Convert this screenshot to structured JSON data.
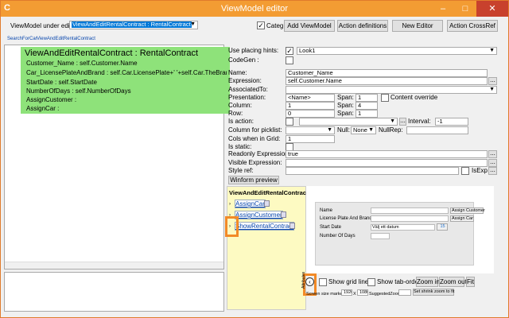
{
  "window": {
    "title": "ViewModel editor",
    "minimize": "–",
    "maximize": "□",
    "close": "✕"
  },
  "toolbar": {
    "under_edit_label": "ViewModel under edit:",
    "under_edit_value": "ViewAndEditRentalContract : RentalContract",
    "categ_label": "Categ",
    "add_viewmodel": "Add ViewModel",
    "action_definitions": "Action definitions",
    "new_editor": "New Editor",
    "action_crossref": "Action CrossRef"
  },
  "breadcrumb": {
    "part1": "SearchForCar",
    "part2": "ViewAndEditRentalContract"
  },
  "viewmodel_tree": {
    "title": "ViewAndEditRentalContract : RentalContract",
    "lines": [
      "Customer_Name : self.Customer.Name",
      "Car_LicensePlateAndBrand : self.Car.LicensePlate+' '+self.Car.TheBrandOfThe",
      "StartDate : self.StartDate",
      "NumberOfDays : self.NumberOfDays",
      "AssignCustomer :",
      "AssignCar :"
    ]
  },
  "props": {
    "placing_hints_label": "Use placing hints:",
    "placing_hints_value": "Look1",
    "codegen_label": "CodeGen :",
    "name_label": "Name:",
    "name_value": "Customer_Name",
    "expression_label": "Expression:",
    "expression_value": "self.Customer.Name",
    "associated_label": "AssociatedTo:",
    "presentation_label": "Presentation:",
    "presentation_value": "<Name>",
    "span_label": "Span:",
    "span1_value": "1",
    "content_override_label": "Content override",
    "column_label": "Column:",
    "column_value": "1",
    "span2_value": "4",
    "row_label": "Row:",
    "row_value": "0",
    "span3_value": "1",
    "is_action_label": "Is action:",
    "interval_label": "Interval:",
    "interval_value": "-1",
    "column_picklist_label": "Column for picklist:",
    "null_label": "Null:",
    "null_value": "None",
    "nullrep_label": "NullRep:",
    "cols_grid_label": "Cols when in Grid:",
    "cols_grid_value": "1",
    "is_static_label": "Is static:",
    "readonly_label": "Readonly Expression:",
    "readonly_value": "true",
    "visible_label": "Visible Expression:",
    "style_label": "Style ref:",
    "isexp_label": "IsExp",
    "winform_preview": "Winform preview",
    "ellipsis": "..."
  },
  "preview": {
    "title": "ViewAndEditRentalContract",
    "items": [
      "AssignCar",
      "AssignCustomer",
      "ShowRentalContract"
    ]
  },
  "form": {
    "name_label": "Name",
    "license_label": "License Plate And Brand",
    "start_label": "Start Date",
    "start_value": "Välj ett datum",
    "date_icon_text": "15",
    "days_label": "Number Of Days",
    "assign_customer": "Assign Customer",
    "assign_car": "Assign Car"
  },
  "bottom": {
    "attributes_label": "Attributes",
    "show_grid_lines": "Show grid lines",
    "show_tab_order": "Show tab-order",
    "zoom_in": "Zoom in",
    "zoom_out": "Zoom out",
    "fit": "Fit",
    "screen_size_label": "Screen size marker",
    "width_value": "1920",
    "x_label": "X",
    "height_value": "1080",
    "suggested_label": "SuggestedZoom",
    "set_shrink": "Set shrink zoom to fit"
  },
  "colors": {
    "title_bar": "#f39c33",
    "close": "#c8412d",
    "viewmodel_box": "#8ee27a",
    "preview_bg": "#fdfac2",
    "highlight": "#f28a27"
  }
}
